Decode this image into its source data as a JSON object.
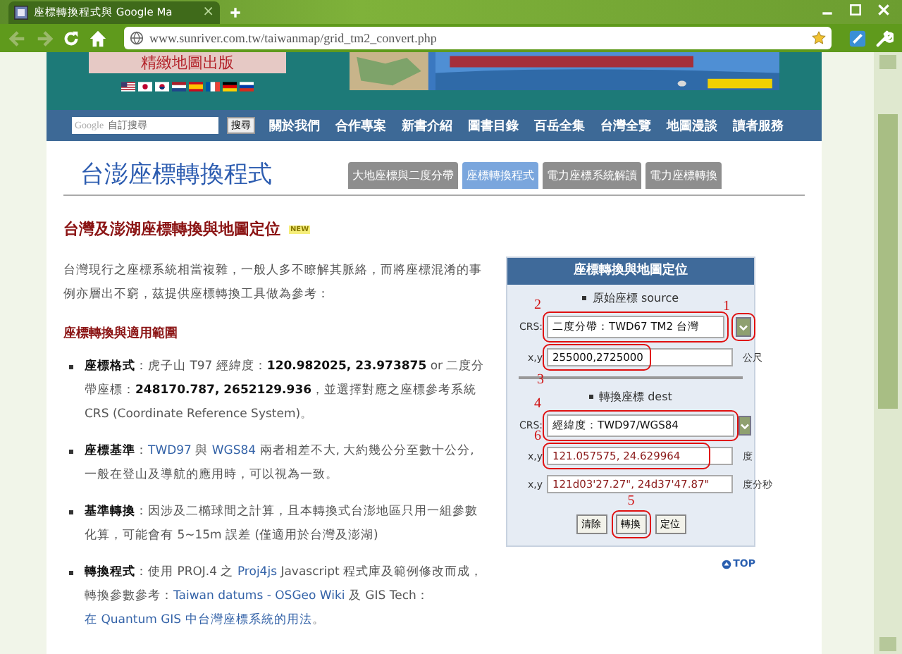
{
  "browser": {
    "tab_title": "座標轉換程式與 Google Ma",
    "tab_close": "×",
    "url": "www.sunriver.com.tw/taiwanmap/grid_tm2_convert.php"
  },
  "header": {
    "publisher_label": "精緻地圖出版",
    "flags": [
      {
        "kind": "us"
      },
      {
        "kind": "jp"
      },
      {
        "kind": "kr"
      },
      {
        "kind": "nl"
      },
      {
        "kind": "es"
      },
      {
        "kind": "fr"
      },
      {
        "kind": "de"
      },
      {
        "kind": "ru"
      }
    ]
  },
  "search": {
    "logo": "Google",
    "placeholder": "自訂搜尋",
    "button": "搜尋"
  },
  "nav": [
    "關於我們",
    "合作專案",
    "新書介紹",
    "圖書目錄",
    "百岳全集",
    "台灣全覽",
    "地圖漫談",
    "讀者服務"
  ],
  "page_title": "台澎座標轉換程式",
  "tabs": [
    {
      "label": "大地座標與二度分帶",
      "selected": false
    },
    {
      "label": "座標轉換程式",
      "selected": true
    },
    {
      "label": "電力座標系統解讀",
      "selected": false
    },
    {
      "label": "電力座標轉換",
      "selected": false
    }
  ],
  "heading": "台灣及澎湖座標轉換與地圖定位",
  "badge": "NEW",
  "intro": "台灣現行之座標系統相當複雜，一般人多不瞭解其脈絡，而將座標混淆的事例亦層出不窮，茲提供座標轉換工具做為參考：",
  "subheading": "座標轉換與適用範圍",
  "bullets": [
    {
      "parts": [
        {
          "kind": "bold",
          "text": "座標格式"
        },
        {
          "kind": "plain",
          "text": "：虎子山 T97 經緯度："
        },
        {
          "kind": "bold",
          "text": "120.982025, 23.973875"
        },
        {
          "kind": "plain",
          "text": " or 二度分帶座標："
        },
        {
          "kind": "bold",
          "text": "248170.787, 2652129.936"
        },
        {
          "kind": "plain",
          "text": "，並選擇對應之座標參考系統 CRS (Coordinate Reference System)。"
        }
      ]
    },
    {
      "parts": [
        {
          "kind": "bold",
          "text": "座標基準"
        },
        {
          "kind": "plain",
          "text": "："
        },
        {
          "kind": "link",
          "text": "TWD97"
        },
        {
          "kind": "plain",
          "text": " 與 "
        },
        {
          "kind": "link",
          "text": "WGS84"
        },
        {
          "kind": "plain",
          "text": " 兩者相差不大, 大約幾公分至數十公分, 一般在登山及導航的應用時，可以視為一致。"
        }
      ]
    },
    {
      "parts": [
        {
          "kind": "bold",
          "text": "基準轉換"
        },
        {
          "kind": "plain",
          "text": "：因涉及二橢球間之計算，且本轉換式台澎地區只用一組參數化算，可能會有 5~15m 誤差 (僅適用於台灣及澎湖)"
        }
      ]
    },
    {
      "parts": [
        {
          "kind": "bold",
          "text": "轉換程式"
        },
        {
          "kind": "plain",
          "text": "：使用 PROJ.4 之 "
        },
        {
          "kind": "link",
          "text": "Proj4js"
        },
        {
          "kind": "plain",
          "text": " Javascript 程式庫及範例修改而成，轉換參數參考："
        },
        {
          "kind": "link",
          "text": "Taiwan datums - OSGeo Wiki"
        },
        {
          "kind": "plain",
          "text": " 及 GIS Tech："
        },
        {
          "kind": "link",
          "text": "在 Quantum GIS 中台灣座標系統的用法"
        },
        {
          "kind": "plain",
          "text": "。"
        }
      ]
    }
  ],
  "panel": {
    "title": "座標轉換與地圖定位",
    "source": {
      "heading": "原始座標 source",
      "crs_label": "CRS:",
      "crs_value": "二度分帶：TWD67 TM2 台灣",
      "crs_marker": "2",
      "arrow_marker": "1",
      "xy_label": "x,y",
      "xy_value": "255000,2725000",
      "xy_marker": "3",
      "unit": "公尺"
    },
    "dest": {
      "heading": "轉換座標 dest",
      "crs_label": "CRS:",
      "crs_value": "經緯度：TWD97/WGS84",
      "crs_marker": "4",
      "outputs": [
        {
          "label": "x,y",
          "value": "121.057575, 24.629964",
          "unit": "度",
          "marker": "6"
        },
        {
          "label": "x,y",
          "value": "121d03'27.27\", 24d37'47.87\"",
          "unit": "度分秒"
        }
      ]
    },
    "buttons": [
      {
        "label": "清除"
      },
      {
        "label": "轉換",
        "marker": "5"
      },
      {
        "label": "定位"
      }
    ]
  },
  "top_link": "TOP"
}
